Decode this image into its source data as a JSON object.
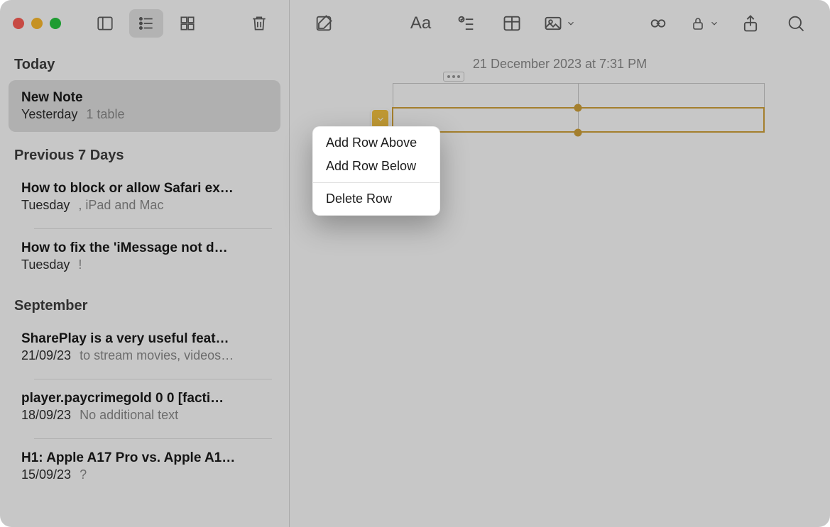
{
  "sidebar": {
    "sections": [
      {
        "label": "Today",
        "items": [
          {
            "title": "New Note",
            "date": "Yesterday",
            "preview": "1 table",
            "selected": true
          }
        ]
      },
      {
        "label": "Previous 7 Days",
        "items": [
          {
            "title": "How to block or allow Safari ex…",
            "date": "Tuesday",
            "preview": ", iPad and Mac"
          },
          {
            "title": "How to fix the 'iMessage not d…",
            "date": "Tuesday",
            "preview": "!"
          }
        ]
      },
      {
        "label": "September",
        "items": [
          {
            "title": "SharePlay is a very useful feat…",
            "date": "21/09/23",
            "preview": "to stream movies, videos…"
          },
          {
            "title": "player.paycrimegold 0 0 [facti…",
            "date": "18/09/23",
            "preview": "No additional text"
          },
          {
            "title": "H1: Apple A17 Pro vs. Apple A1…",
            "date": "15/09/23",
            "preview": "?"
          }
        ]
      }
    ]
  },
  "toolbar_left": {
    "sidebar_toggle": "sidebar-toggle",
    "list_view": "list-view",
    "grid_view": "grid-view",
    "delete": "delete"
  },
  "main": {
    "timestamp": "21 December 2023 at 7:31 PM"
  },
  "context_menu": {
    "add_above": "Add Row Above",
    "add_below": "Add Row Below",
    "delete_row": "Delete Row"
  }
}
